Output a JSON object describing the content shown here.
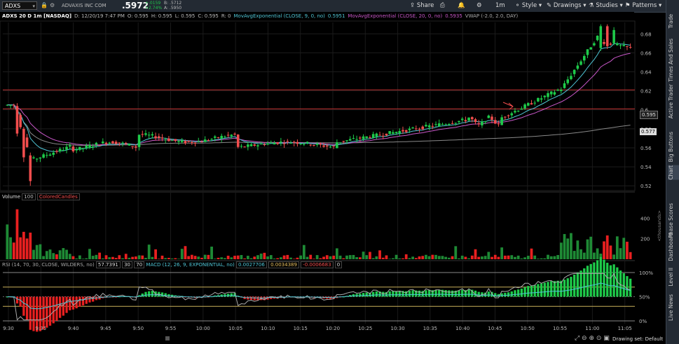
{
  "header": {
    "symbol": "ADXS",
    "company": "ADVAXIS INC COM",
    "last": ".5972",
    "change_abs": "+.0159",
    "change_pct": "+2.74%",
    "bid": "B: .5712",
    "ask": "A: .5950",
    "share": "Share",
    "timeframe": "1m",
    "style": "Style",
    "drawings": "Drawings",
    "studies": "Studies",
    "patterns": "Patterns"
  },
  "infobar": {
    "title": "ADXS 20 D 1m [NASDAQ]",
    "date": "D: 12/20/19 7:47 PM",
    "open": "O: 0.595",
    "high": "H: 0.595",
    "low": "L: 0.595",
    "close": "C: 0.595",
    "range": "R: 0",
    "ema9": "MovAvgExponential (CLOSE, 9, 0, no)",
    "ema9_val": "0.5951",
    "ema20": "MovAvgExponential (CLOSE, 20, 0, no)",
    "ema20_val": "0.5935",
    "vwap": "VWAP (-2.0, 2.0, DAY)"
  },
  "volume_bar": {
    "label": "Volume",
    "val": "100",
    "colored": "ColoredCandles",
    "unit": "<thousands>"
  },
  "osc_bar": {
    "rsi": "RSI (14, 70, 30, CLOSE, WILDERS, no)",
    "rsi_val": "57.7391",
    "rsi_ob": "30",
    "rsi_os": "70",
    "macd": "MACD (12, 26, 9, EXPONENTIAL, no)",
    "macd_v1": "0.0027706",
    "macd_v2": "0.0034389",
    "macd_v3": "-0.0006683",
    "macd_v4": "0"
  },
  "price_axis": [
    "0.68",
    "0.66",
    "0.64",
    "0.62",
    "0.6",
    "0.58",
    "0.56",
    "0.54",
    "0.52"
  ],
  "volume_axis": [
    "400",
    "200"
  ],
  "osc_axis": [
    "100%",
    "50%",
    "0%"
  ],
  "time_axis": [
    "9:30",
    "9:35",
    "9:40",
    "9:45",
    "9:50",
    "9:55",
    "10:00",
    "10:05",
    "10:10",
    "10:15",
    "10:20",
    "10:25",
    "10:30",
    "10:35",
    "10:40",
    "10:45",
    "10:50",
    "10:55",
    "11:00",
    "11:05"
  ],
  "price_tags": {
    "current": "0.595",
    "vwap": "0.577"
  },
  "right_tabs": [
    "Trade",
    "Times And Sales",
    "Active Trader",
    "Big Buttons",
    "Chart",
    "Phase Scores",
    "Dashboard",
    "Level II",
    "Live News"
  ],
  "footer": {
    "drawing_set": "Drawing set: Default"
  },
  "colors": {
    "up": "#1ecb4a",
    "down": "#f24d4d",
    "ema9": "#4fc6d6",
    "ema20": "#c857c8",
    "vwap": "#888888",
    "resistance": "#c03030"
  }
}
